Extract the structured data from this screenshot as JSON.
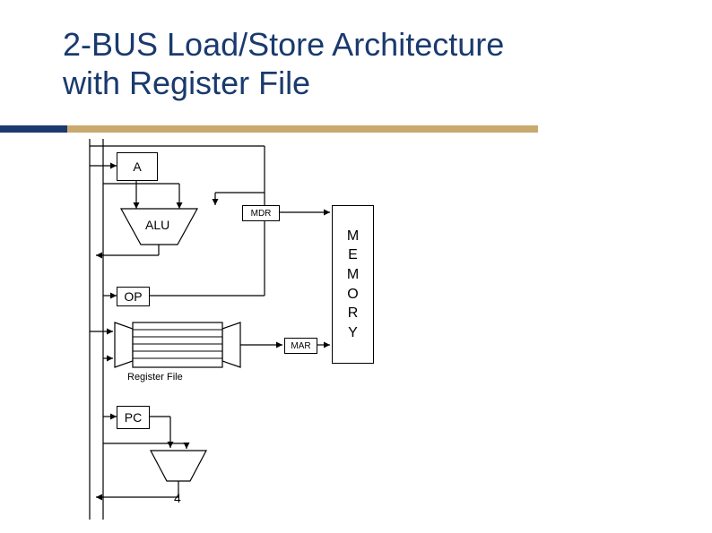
{
  "title_line1": "2-BUS Load/Store Architecture",
  "title_line2": "with Register File",
  "blocks": {
    "A": "A",
    "ALU": "ALU",
    "MDR": "MDR",
    "OP": "OP",
    "MAR": "MAR",
    "RegisterFile": "Register File",
    "PC": "PC",
    "Inc": "4",
    "Memory": "M\nE\nM\nO\nR\nY"
  }
}
